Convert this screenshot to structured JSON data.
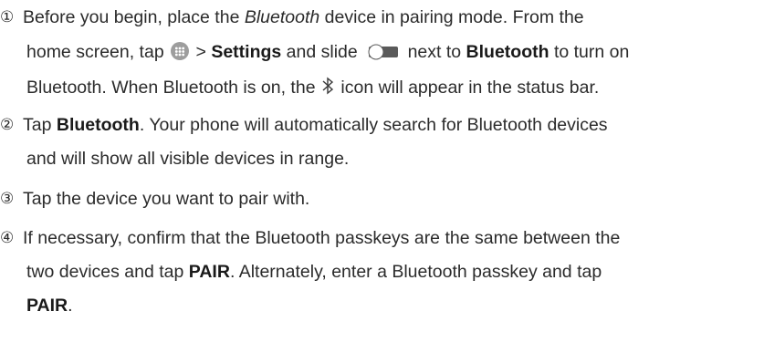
{
  "steps": [
    {
      "marker": "①",
      "lines": [
        {
          "t1": "Before you begin, place the ",
          "italic": "Bluetooth",
          "t2": " device in pairing mode. From the"
        },
        {
          "t1": "home screen, tap ",
          "t2": " > ",
          "bold1": "Settings",
          "t3": " and slide ",
          "t4": " next to ",
          "bold2": "Bluetooth",
          "t5": " to turn on"
        },
        {
          "t1": "Bluetooth. When Bluetooth is on, the ",
          "t2": " icon will appear in the status bar."
        }
      ]
    },
    {
      "marker": "②",
      "lines": [
        {
          "t1": "Tap ",
          "bold1": "Bluetooth",
          "t2": ". Your phone will automatically search for Bluetooth devices"
        },
        {
          "t1": "and will show all visible devices in range."
        }
      ]
    },
    {
      "marker": "③",
      "lines": [
        {
          "t1": "Tap the device you want to pair with."
        }
      ]
    },
    {
      "marker": "④",
      "lines": [
        {
          "t1": "If necessary, confirm that the Bluetooth passkeys are the same between the"
        },
        {
          "t1": "two devices and tap ",
          "bold1": "PAIR",
          "t2": ". Alternately, enter a Bluetooth passkey and tap"
        },
        {
          "bold1": "PAIR",
          "t1": "."
        }
      ]
    }
  ],
  "icons": {
    "apps": "apps-icon",
    "toggle": "toggle-switch-icon",
    "bluetooth": "bluetooth-icon"
  },
  "colors": {
    "text": "#2b2b2b",
    "icon_gray": "#9d9d9d",
    "toggle_track": "#5a5a5a"
  }
}
